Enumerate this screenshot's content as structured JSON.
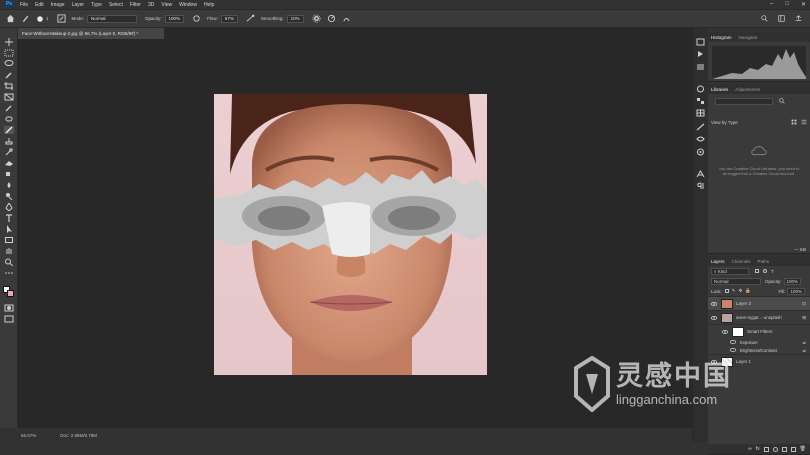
{
  "app": {
    "logo": "Ps"
  },
  "menu": [
    "File",
    "Edit",
    "Image",
    "Layer",
    "Type",
    "Select",
    "Filter",
    "3D",
    "View",
    "Window",
    "Help"
  ],
  "window_controls": [
    "–",
    "□",
    "✕"
  ],
  "options": {
    "mode_label": "Mode:",
    "mode_value": "Normal",
    "opacity_label": "Opacity:",
    "opacity_value": "100%",
    "flow_label": "Flow:",
    "flow_value": "67%",
    "smoothing_label": "Smoothing:",
    "smoothing_value": "10%",
    "brush_size": "1"
  },
  "document_tab": {
    "title": "Face-Without-Makeup-2.jpg @ 66.7% (Layer 0, RGB/8#) *"
  },
  "status": {
    "zoom": "66.67%",
    "doc": "Doc: 2.98M/8.78M"
  },
  "histogram_panel": {
    "tabs": [
      "Histogram",
      "Navigator"
    ]
  },
  "libraries_panel": {
    "tabs": [
      "Libraries",
      "Adjustments"
    ],
    "view_by": "View by Type",
    "message": "You are Creative Cloud Libraries, you need to be logged into a Creative Cloud account.",
    "count": "— KB"
  },
  "layers_panel": {
    "tabs": [
      "Layers",
      "Channels",
      "Paths"
    ],
    "kind": "Kind",
    "blend": "Normal",
    "opacity_label": "Opacity:",
    "opacity_value": "100%",
    "lock_label": "Lock:",
    "fill_label": "Fill:",
    "fill_value": "100%",
    "layers": [
      {
        "name": "Layer 3",
        "active": true
      },
      {
        "name": "anne-nygar...-unsplash",
        "active": false
      }
    ],
    "smart_filters": "Smart Filters",
    "filters": [
      "Exposure",
      "Brightness/Contrast"
    ],
    "bottom_layer": "Layer 1"
  },
  "watermark": {
    "title": "灵感中国",
    "url": "lingganchina.com"
  },
  "colors": {
    "accent": "#31a8ff",
    "workspace": "#282828",
    "panel": "#3a3a3a"
  }
}
